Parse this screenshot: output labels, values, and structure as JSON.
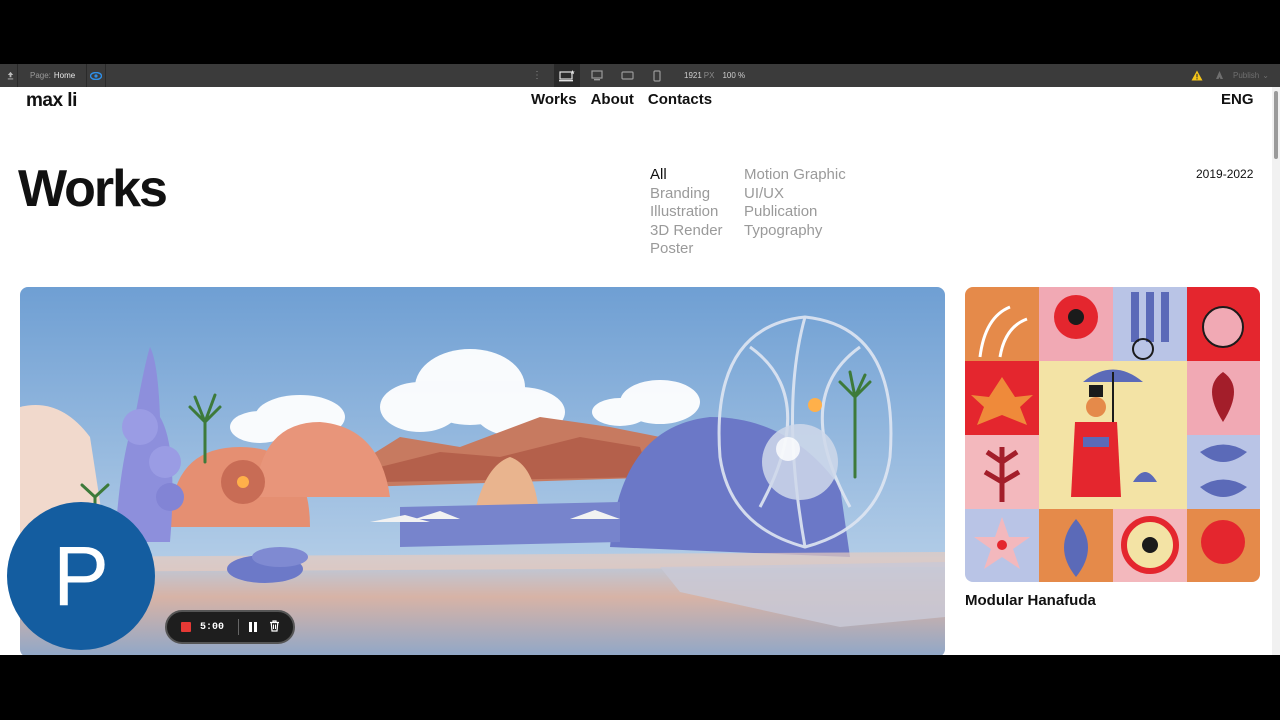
{
  "editor": {
    "page_label": "Page:",
    "page_name": "Home",
    "viewport_width": "1921",
    "viewport_unit": "PX",
    "zoom": "100 %",
    "publish_label": "Publish"
  },
  "site": {
    "logo": "max li",
    "nav": [
      "Works",
      "About",
      "Contacts"
    ],
    "language": "ENG",
    "heading": "Works",
    "years": "2019-2022",
    "filters_col1": [
      "All",
      "Branding",
      "Illustration",
      "3D Render",
      "Poster"
    ],
    "filters_col2": [
      "Motion Graphic",
      "UI/UX",
      "Publication",
      "Typography"
    ],
    "active_filter": "All",
    "cards": [
      {
        "title": "Modular Hanafuda"
      }
    ]
  },
  "overlay": {
    "avatar_letter": "P",
    "recording_time": "5:00"
  },
  "colors": {
    "editor_bar": "#3b3b3b",
    "avatar": "#145da0",
    "record": "#e53935"
  }
}
